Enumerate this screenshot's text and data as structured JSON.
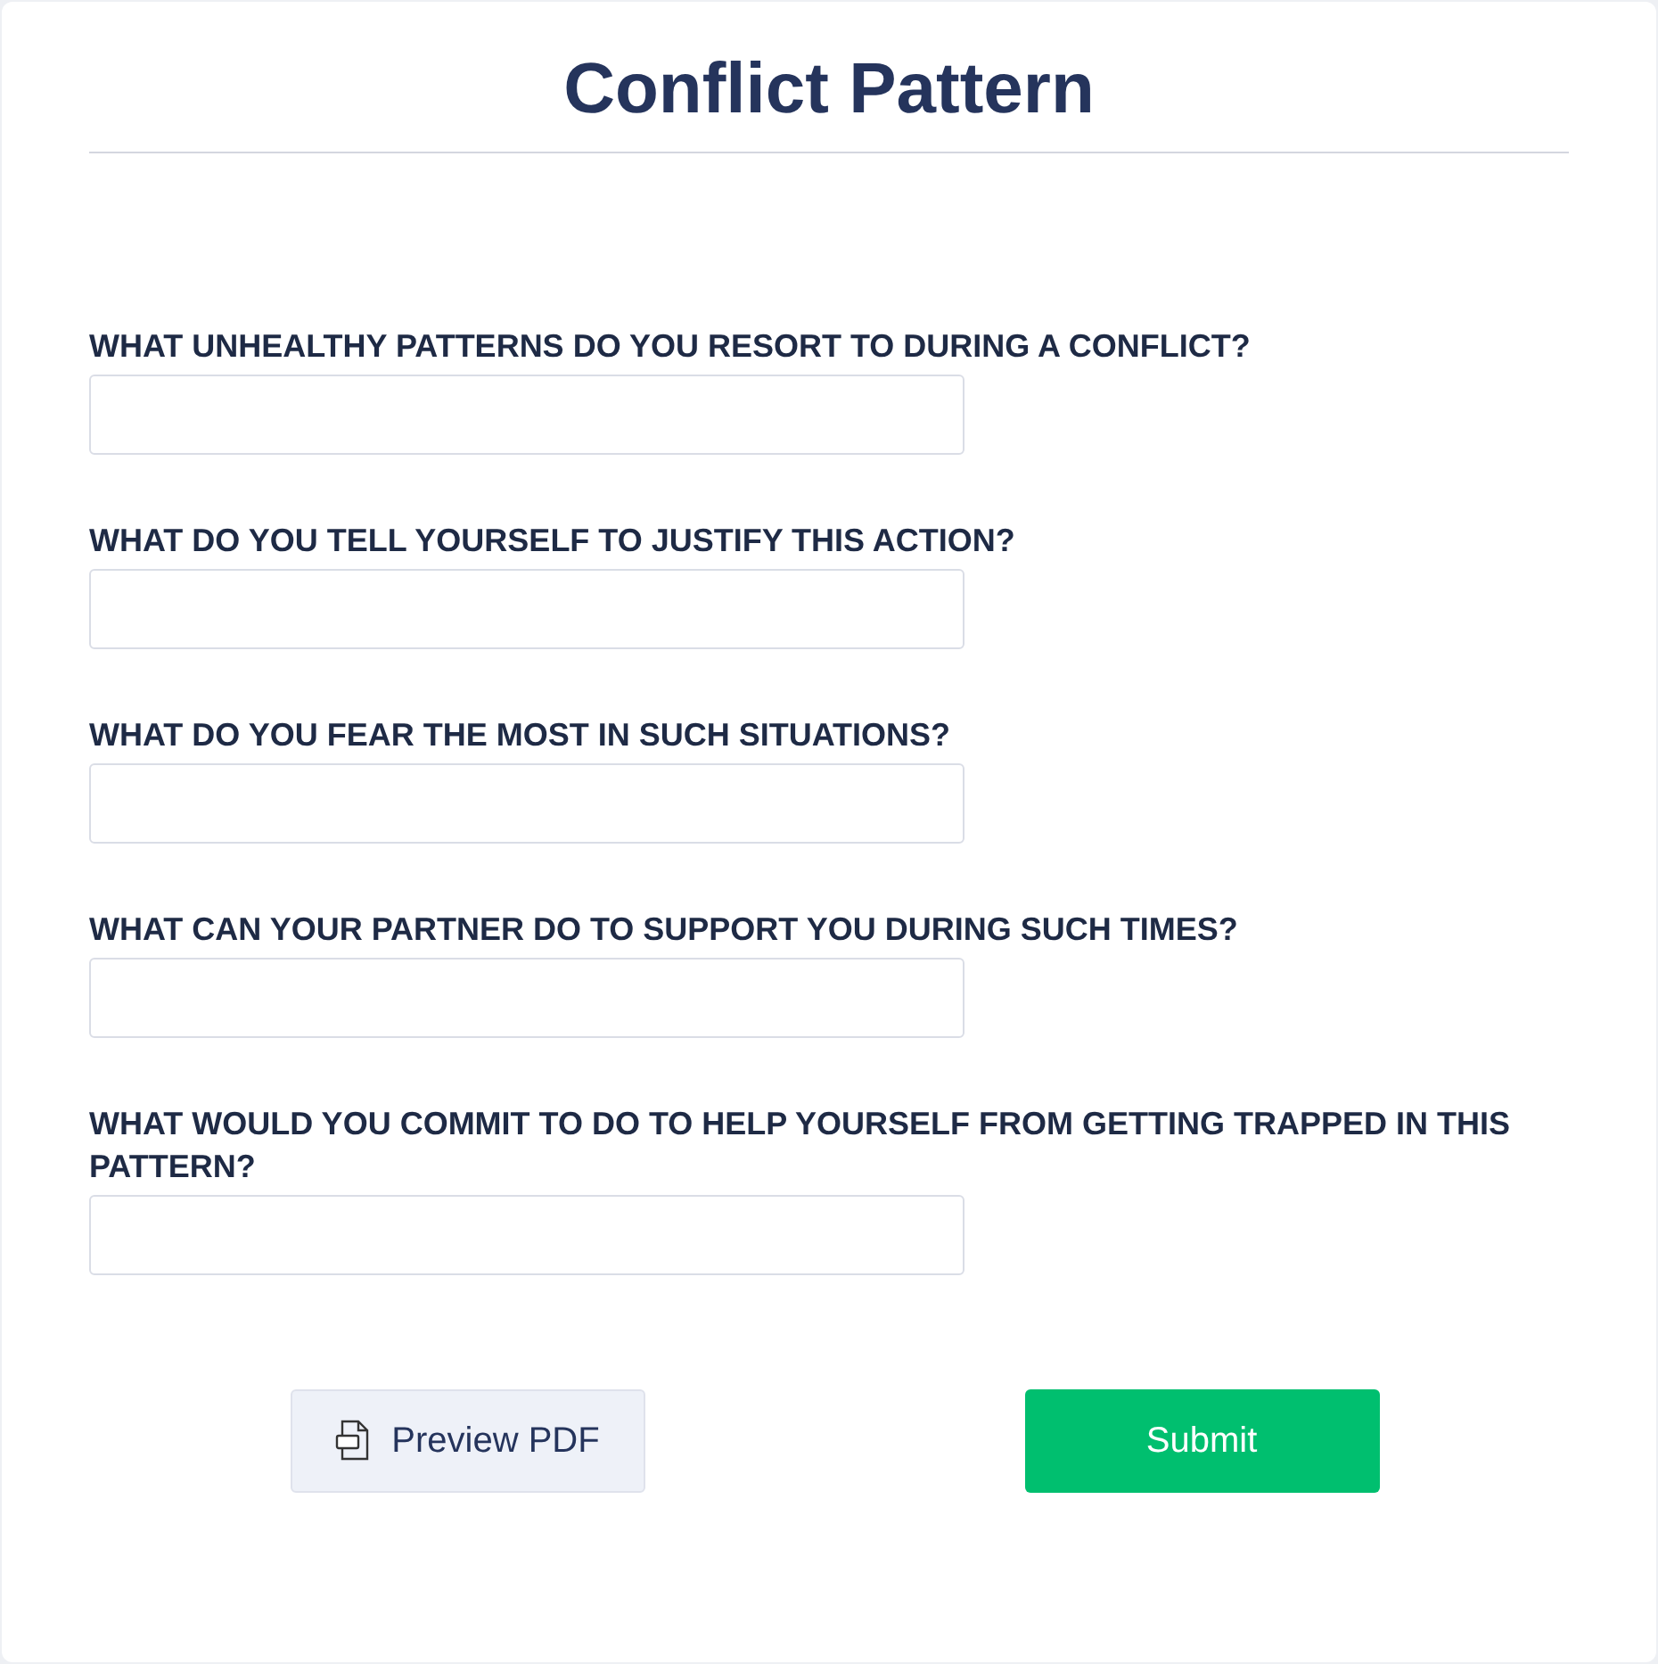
{
  "title": "Conflict Pattern",
  "questions": [
    {
      "label": "WHAT UNHEALTHY PATTERNS DO YOU RESORT TO DURING A CONFLICT?"
    },
    {
      "label": "WHAT DO YOU TELL YOURSELF TO JUSTIFY THIS ACTION?"
    },
    {
      "label": "WHAT DO YOU FEAR THE MOST IN SUCH SITUATIONS?"
    },
    {
      "label": "WHAT CAN YOUR PARTNER DO TO SUPPORT YOU DURING SUCH TIMES?"
    },
    {
      "label": "WHAT WOULD YOU COMMIT TO DO TO HELP YOURSELF FROM GETTING TRAPPED IN THIS PATTERN?"
    }
  ],
  "buttons": [
    {
      "kind": "preview",
      "label": "Preview PDF"
    },
    {
      "kind": "submit",
      "label": "Submit"
    }
  ]
}
